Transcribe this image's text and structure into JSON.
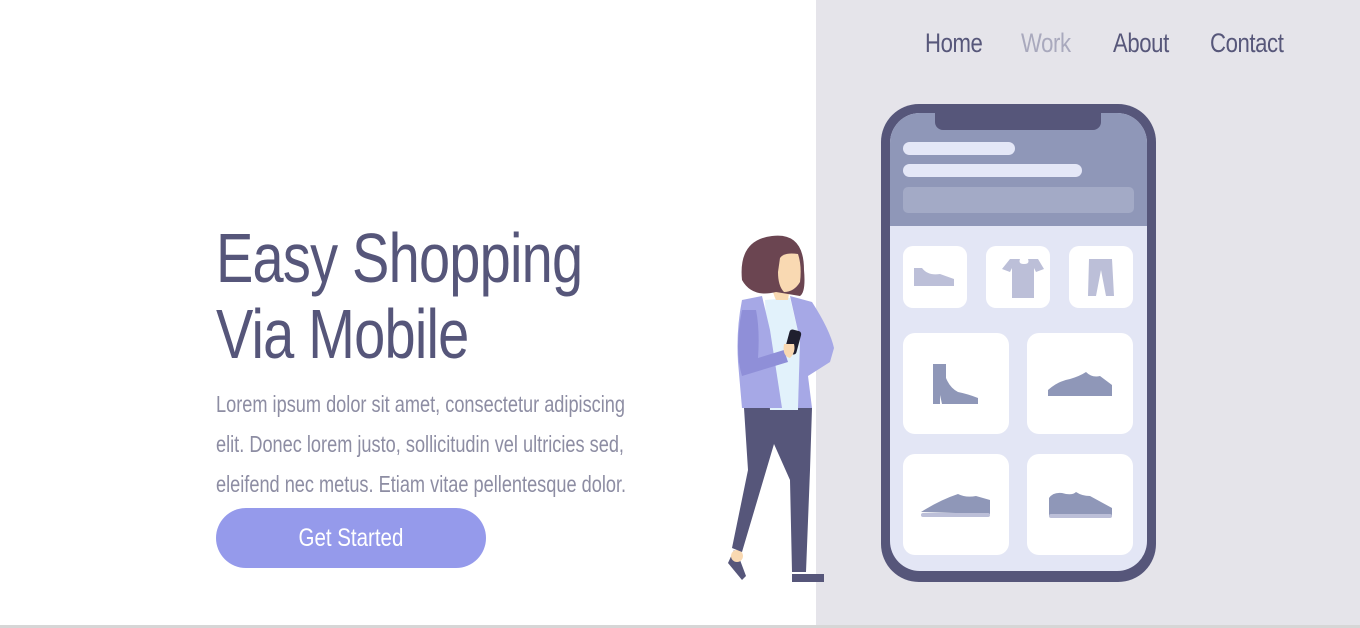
{
  "nav": {
    "items": [
      {
        "label": "Home",
        "active": false
      },
      {
        "label": "Work",
        "active": true
      },
      {
        "label": "About",
        "active": false
      },
      {
        "label": "Contact",
        "active": false
      }
    ]
  },
  "hero": {
    "title_line1": "Easy Shopping",
    "title_line2": "Via Mobile",
    "text_line1": "Lorem ipsum dolor sit amet, consectetur adipiscing",
    "text_line2": "elit. Donec lorem justo, sollicitudin vel ultricies sed,",
    "text_line3": "eleifend nec metus. Etiam vitae pellentesque dolor.",
    "cta_label": "Get Started"
  },
  "colors": {
    "title": "#56567a",
    "body_text": "#8d8da3",
    "accent_button": "#959aeb",
    "nav_active": "#a9a9bd",
    "panel_bg": "#e5e4ea",
    "phone_frame": "#56567a"
  },
  "illustration": {
    "icons": [
      "shoe-icon",
      "tshirt-icon",
      "pants-icon",
      "boot-icon",
      "sneaker-icon",
      "flat-shoe-icon",
      "low-sneaker-icon"
    ]
  }
}
